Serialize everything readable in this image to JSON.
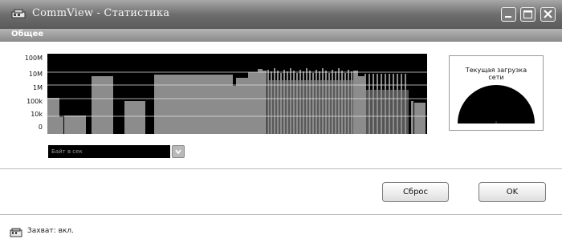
{
  "window": {
    "title": "CommView - Статистика",
    "icon": "network-card-icon"
  },
  "section": {
    "title": "Общее"
  },
  "graph": {
    "y_axis_labels": [
      "100M",
      "10M",
      "1M",
      "100k",
      "10k",
      "0"
    ],
    "scale": "log",
    "colors": {
      "background": "#000000",
      "bars": "#8c8c8c",
      "grid": "#e0e0e0"
    }
  },
  "gauge": {
    "title_line1": "Текущая загрузка",
    "title_line2": "сети",
    "value": "",
    "colors": {
      "fill": "#000000"
    }
  },
  "metric_select": {
    "value": "Байт в сек"
  },
  "buttons": {
    "reset": "Сброс",
    "ok": "OK"
  },
  "status": {
    "text": "Захват: вкл.",
    "icon": "capture-adapter-icon"
  }
}
